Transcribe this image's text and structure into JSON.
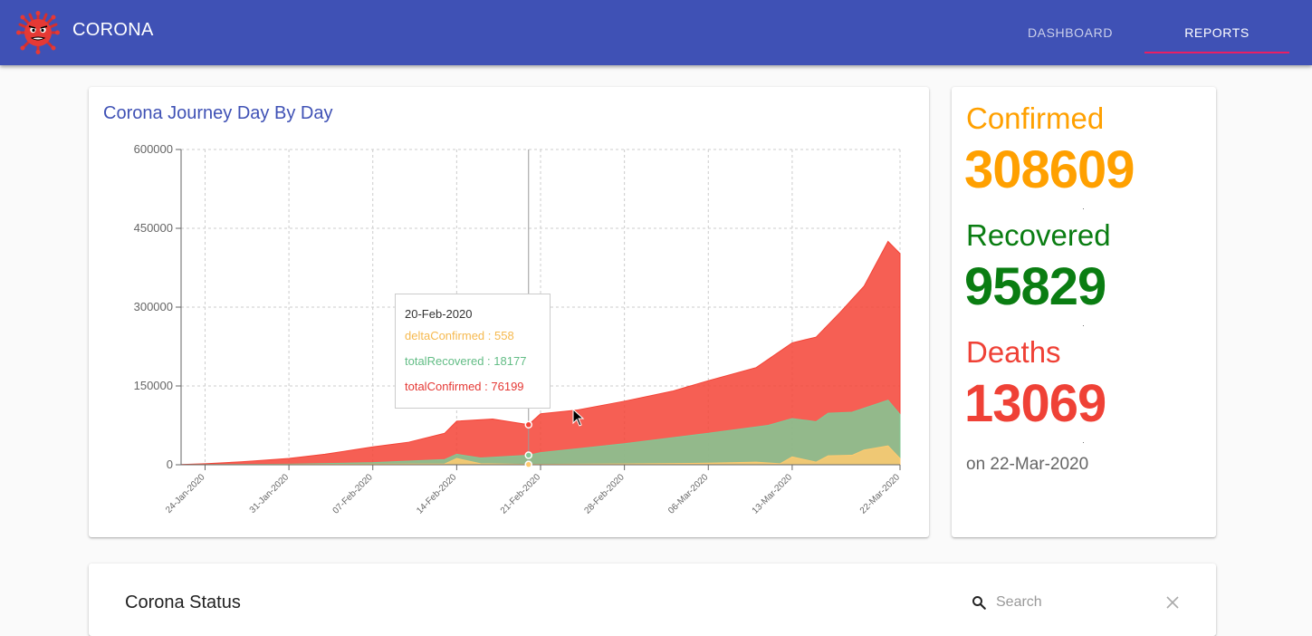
{
  "app": {
    "title": "CORONA",
    "tabs": [
      {
        "label": "DASHBOARD",
        "active": false
      },
      {
        "label": "REPORTS",
        "active": true
      }
    ],
    "colors": {
      "primary": "#3f51b5",
      "indicator": "#e91e63"
    }
  },
  "chart_card": {
    "title": "Corona Journey Day By Day"
  },
  "chart_data": {
    "type": "area",
    "title": "Corona Journey Day By Day",
    "ylim": [
      0,
      600000
    ],
    "y_ticks": [
      0,
      150000,
      300000,
      450000,
      600000
    ],
    "x_range": [
      "22-Jan-2020",
      "22-Mar-2020"
    ],
    "x_ticks": [
      "24-Jan-2020",
      "31-Jan-2020",
      "07-Feb-2020",
      "14-Feb-2020",
      "21-Feb-2020",
      "28-Feb-2020",
      "06-Mar-2020",
      "13-Mar-2020",
      "22-Mar-2020"
    ],
    "grid": true,
    "series": [
      {
        "name": "totalConfirmed",
        "color": "#f44336",
        "points": [
          [
            "22-Jan-2020",
            555
          ],
          [
            "24-Jan-2020",
            2000
          ],
          [
            "27-Jan-2020",
            5500
          ],
          [
            "31-Jan-2020",
            12000
          ],
          [
            "03-Feb-2020",
            20000
          ],
          [
            "07-Feb-2020",
            34000
          ],
          [
            "10-Feb-2020",
            43000
          ],
          [
            "13-Feb-2020",
            60000
          ],
          [
            "14-Feb-2020",
            83000
          ],
          [
            "17-Feb-2020",
            87000
          ],
          [
            "20-Feb-2020",
            76199
          ],
          [
            "21-Feb-2020",
            97000
          ],
          [
            "24-Feb-2020",
            104000
          ],
          [
            "28-Feb-2020",
            121000
          ],
          [
            "03-Mar-2020",
            140000
          ],
          [
            "06-Mar-2020",
            160000
          ],
          [
            "10-Mar-2020",
            185000
          ],
          [
            "13-Mar-2020",
            232000
          ],
          [
            "15-Mar-2020",
            243000
          ],
          [
            "17-Mar-2020",
            290000
          ],
          [
            "19-Mar-2020",
            340000
          ],
          [
            "21-Mar-2020",
            425000
          ],
          [
            "22-Mar-2020",
            402000
          ]
        ]
      },
      {
        "name": "totalRecovered",
        "color": "#81c995",
        "points": [
          [
            "22-Jan-2020",
            0
          ],
          [
            "31-Jan-2020",
            1000
          ],
          [
            "07-Feb-2020",
            4000
          ],
          [
            "13-Feb-2020",
            10000
          ],
          [
            "14-Feb-2020",
            20000
          ],
          [
            "16-Feb-2020",
            13000
          ],
          [
            "20-Feb-2020",
            18177
          ],
          [
            "21-Feb-2020",
            23000
          ],
          [
            "28-Feb-2020",
            40000
          ],
          [
            "06-Mar-2020",
            60000
          ],
          [
            "11-Mar-2020",
            75000
          ],
          [
            "13-Mar-2020",
            88000
          ],
          [
            "15-Mar-2020",
            82000
          ],
          [
            "16-Mar-2020",
            98000
          ],
          [
            "18-Mar-2020",
            100000
          ],
          [
            "21-Mar-2020",
            123000
          ],
          [
            "22-Mar-2020",
            95829
          ]
        ]
      },
      {
        "name": "deltaConfirmed",
        "color": "#ffca70",
        "points": [
          [
            "22-Jan-2020",
            0
          ],
          [
            "13-Feb-2020",
            1500
          ],
          [
            "14-Feb-2020",
            12000
          ],
          [
            "16-Feb-2020",
            2000
          ],
          [
            "20-Feb-2020",
            558
          ],
          [
            "28-Feb-2020",
            1500
          ],
          [
            "06-Mar-2020",
            3000
          ],
          [
            "10-Mar-2020",
            5000
          ],
          [
            "12-Mar-2020",
            2000
          ],
          [
            "13-Mar-2020",
            15000
          ],
          [
            "15-Mar-2020",
            5000
          ],
          [
            "16-Mar-2020",
            17000
          ],
          [
            "18-Mar-2020",
            18000
          ],
          [
            "19-Mar-2020",
            28000
          ],
          [
            "21-Mar-2020",
            36000
          ],
          [
            "22-Mar-2020",
            12000
          ]
        ]
      }
    ]
  },
  "tooltip": {
    "date": "20-Feb-2020",
    "rows": [
      {
        "text": "deltaConfirmed : 558",
        "color": "#f6b94f"
      },
      {
        "text": "totalRecovered : 18177",
        "color": "#63bd86"
      },
      {
        "text": "totalConfirmed : 76199",
        "color": "#e53935"
      }
    ]
  },
  "stats": {
    "confirmed": {
      "label": "Confirmed",
      "value": "308609",
      "color": "#ffa000"
    },
    "recovered": {
      "label": "Recovered",
      "value": "95829",
      "color": "#0a7d12"
    },
    "deaths": {
      "label": "Deaths",
      "value": "13069",
      "color": "#ef4136"
    },
    "date_text": "on 22-Mar-2020"
  },
  "status_card": {
    "title": "Corona Status",
    "search_placeholder": "Search",
    "search_value": ""
  },
  "icons": {
    "logo": "virus-logo-icon",
    "search": "search-icon",
    "clear": "close-icon"
  }
}
